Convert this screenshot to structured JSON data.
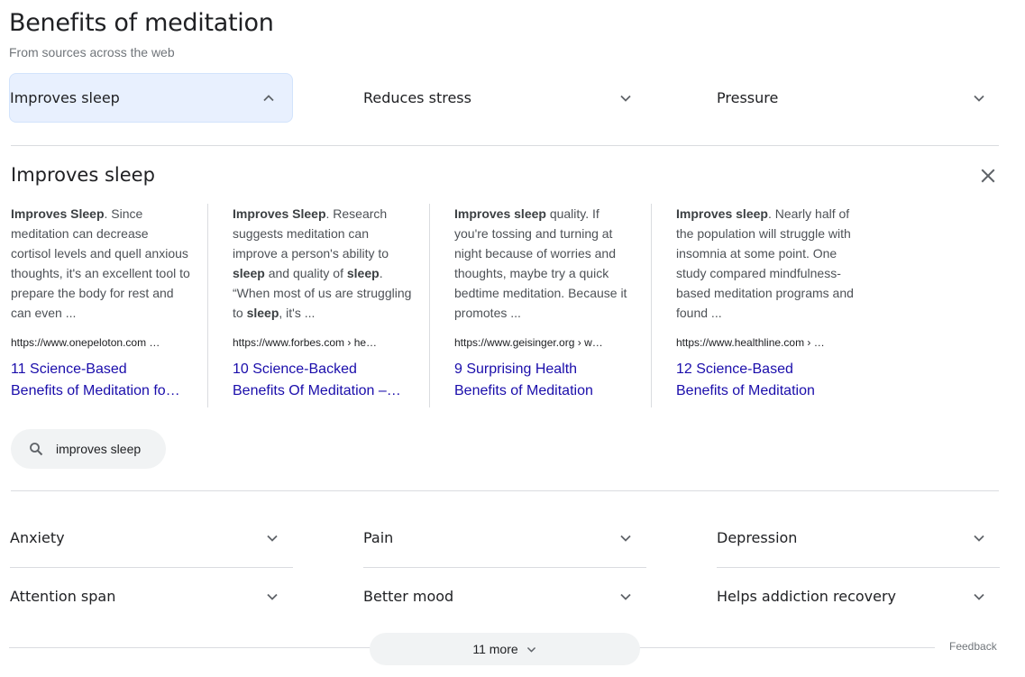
{
  "header": {
    "title": "Benefits of meditation",
    "subtitle": "From sources across the web"
  },
  "top_accordions": [
    {
      "label": "Improves sleep",
      "expanded": true
    },
    {
      "label": "Reduces stress",
      "expanded": false
    },
    {
      "label": "Pressure",
      "expanded": false
    }
  ],
  "expanded_section": {
    "title": "Improves sleep",
    "close_icon": "close-icon",
    "cards": [
      {
        "snippet_bold": "Improves Sleep",
        "snippet_rest": ". Since meditation can decrease cortisol levels and quell anxious thoughts, it's an excellent tool to prepare the body for rest and can even ...",
        "url": "https://www.onepeloton.com …",
        "link_line1": "11 Science-Based",
        "link_line2": "Benefits of Meditation fo…"
      },
      {
        "snippet_parts": [
          {
            "text": "Improves Sleep",
            "bold": true
          },
          {
            "text": ". Research suggests meditation can improve a person's ability to ",
            "bold": false
          },
          {
            "text": "sleep",
            "bold": true
          },
          {
            "text": " and quality of ",
            "bold": false
          },
          {
            "text": "sleep",
            "bold": true
          },
          {
            "text": ". “When most of us are struggling to ",
            "bold": false
          },
          {
            "text": "sleep",
            "bold": true
          },
          {
            "text": ", it's ...",
            "bold": false
          }
        ],
        "url": "https://www.forbes.com › he…",
        "link_line1": "10 Science-Backed",
        "link_line2": "Benefits Of Meditation –…"
      },
      {
        "snippet_bold": "Improves sleep",
        "snippet_rest": " quality. If you're tossing and turning at night because of worries and thoughts, maybe try a quick bedtime meditation. Because it promotes ...",
        "url": "https://www.geisinger.org › w…",
        "link_line1": "9 Surprising Health",
        "link_line2": "Benefits of Meditation"
      },
      {
        "snippet_bold": "Improves sleep",
        "snippet_rest": ". Nearly half of the population will struggle with insomnia at some point. One study compared mindfulness-based meditation programs and found ...",
        "url": "https://www.healthline.com › …",
        "link_line1": "12 Science-Based",
        "link_line2": "Benefits of Meditation"
      }
    ],
    "search_chip": {
      "icon": "search-icon",
      "label": "improves sleep"
    }
  },
  "bottom_accordions": [
    {
      "label": "Anxiety"
    },
    {
      "label": "Pain"
    },
    {
      "label": "Depression"
    },
    {
      "label": "Attention span"
    },
    {
      "label": "Better mood"
    },
    {
      "label": "Helps addiction recovery"
    }
  ],
  "footer": {
    "more_label": "11 more",
    "feedback_label": "Feedback"
  },
  "colors": {
    "link": "#1a0dab",
    "active_bg": "#e8f0fe",
    "chip_bg": "#f1f3f4",
    "divider": "#dadce0"
  }
}
